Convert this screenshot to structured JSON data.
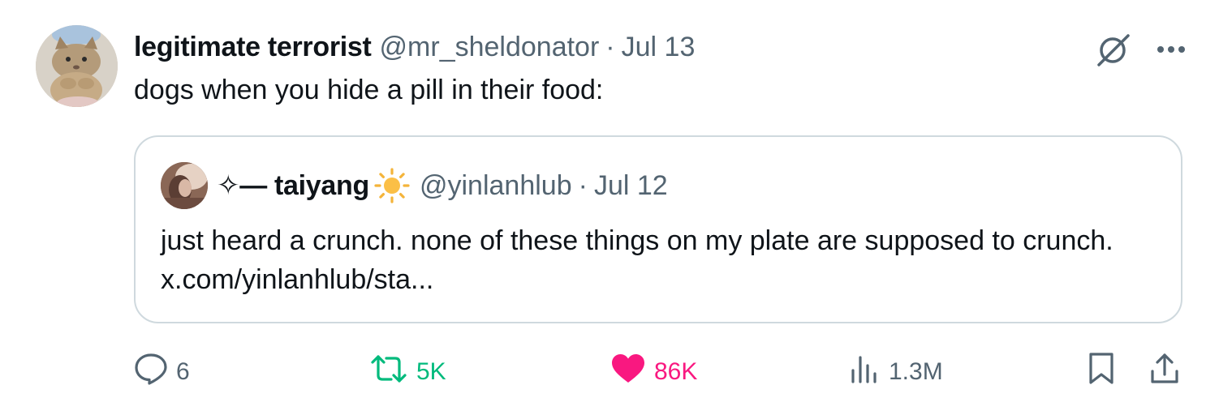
{
  "tweet": {
    "author": {
      "display_name": "legitimate terrorist",
      "handle": "@mr_sheldonator",
      "separator": "·",
      "date": "Jul 13"
    },
    "text": "dogs when you hide a pill in their food:",
    "quoted": {
      "display_name": "✧— taiyang",
      "emoji": "sun-emoji",
      "handle": "@yinlanhlub",
      "separator": "·",
      "date": "Jul 12",
      "text": "just heard a crunch. none of these things on my plate are supposed to crunch. x.com/yinlanhlub/sta..."
    },
    "actions": {
      "replies": "6",
      "retweets": "5K",
      "likes": "86K",
      "views": "1.3M"
    }
  },
  "icons": {
    "grok": "grok-icon",
    "more": "more-icon",
    "reply": "reply-icon",
    "retweet": "retweet-icon",
    "like": "heart-icon",
    "views": "views-icon",
    "bookmark": "bookmark-icon",
    "share": "share-icon"
  },
  "colors": {
    "text": "#0f1419",
    "secondary": "#536471",
    "retweet_active": "#00ba7c",
    "like_active": "#f91880",
    "border": "#cfd9de"
  }
}
